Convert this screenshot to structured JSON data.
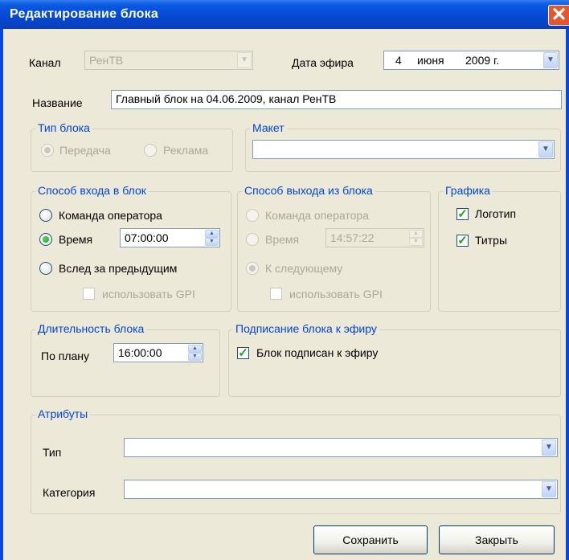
{
  "window": {
    "title": "Редактирование блока"
  },
  "channel": {
    "label": "Канал",
    "value": "РенТВ"
  },
  "air_date": {
    "label": "Дата эфира",
    "day": "4",
    "month": "июня",
    "year": "2009 г."
  },
  "name": {
    "label": "Название",
    "value": "Главный блок на 04.06.2009, канал РенТВ"
  },
  "block_type": {
    "legend": "Тип блока",
    "options": [
      "Передача",
      "Реклама"
    ],
    "selected": "Передача"
  },
  "layout": {
    "legend": "Макет",
    "value": ""
  },
  "entry": {
    "legend": "Способ входа в блок",
    "operator": "Команда оператора",
    "time": "Время",
    "time_value": "07:00:00",
    "after_previous": "Вслед за предыдущим",
    "use_gpi": "использовать GPI",
    "selected": "Время"
  },
  "exit": {
    "legend": "Способ выхода из блока",
    "operator": "Команда оператора",
    "time": "Время",
    "time_value": "14:57:22",
    "to_next": "К следующему",
    "use_gpi": "использовать GPI",
    "selected": "К следующему"
  },
  "graphics": {
    "legend": "Графика",
    "logo": "Логотип",
    "logo_checked": true,
    "titles": "Титры",
    "titles_checked": true
  },
  "duration": {
    "legend": "Длительность блока",
    "label": "По плану",
    "value": "16:00:00"
  },
  "signing": {
    "legend": "Подписание блока к эфиру",
    "label": "Блок подписан к эфиру",
    "checked": true
  },
  "attributes": {
    "legend": "Атрибуты",
    "type_label": "Тип",
    "type_value": "",
    "category_label": "Категория",
    "category_value": ""
  },
  "buttons": {
    "save": "Сохранить",
    "close": "Закрыть"
  },
  "colors": {
    "titlebar": "#0548d4",
    "legend": "#0046d5",
    "window_bg": "#ece9d8",
    "check": "#21a121"
  }
}
